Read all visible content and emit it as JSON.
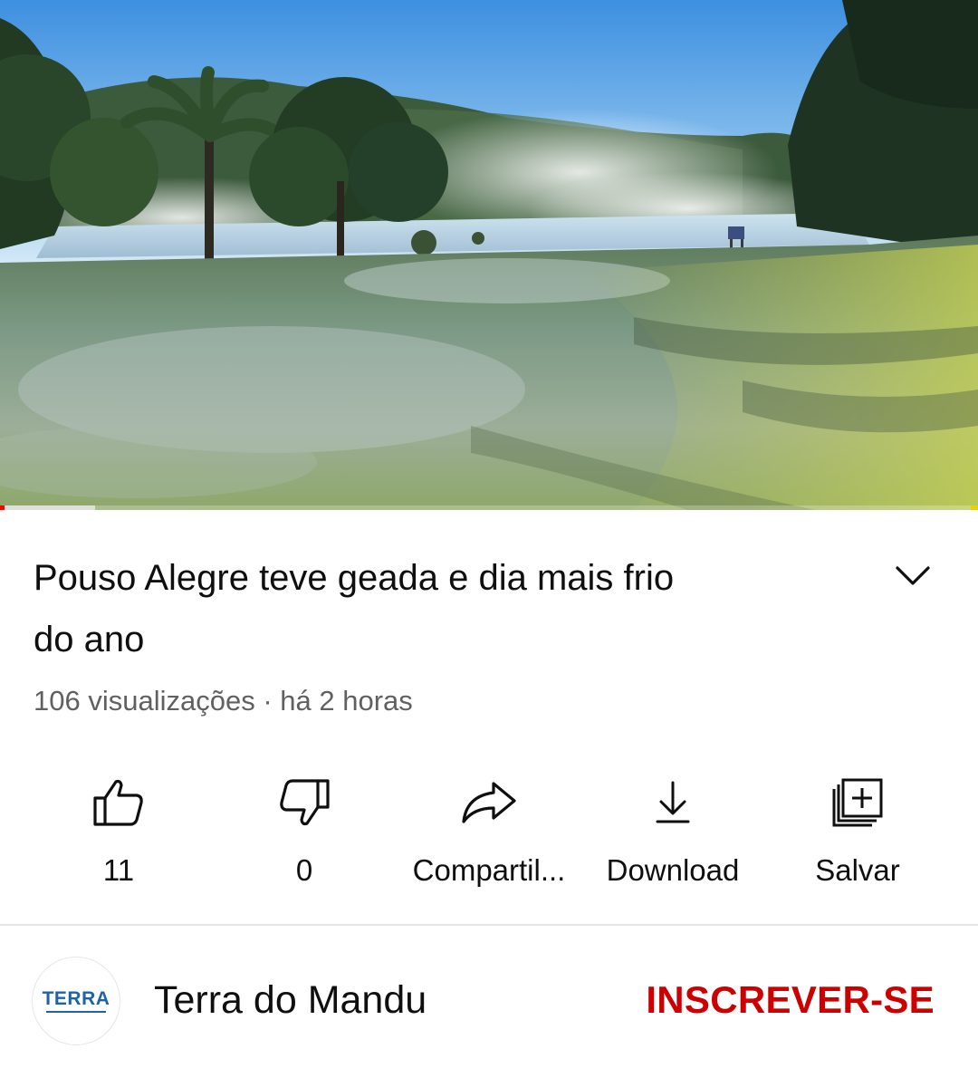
{
  "video": {
    "scene": "frosty-lakeside-meadow-thumbnail",
    "progress": {
      "played_fraction": 0.005,
      "buffered_fraction": 0.097
    }
  },
  "title": {
    "line1": "Pouso Alegre teve geada e dia mais frio",
    "line2": "do ano",
    "expand_icon": "chevron-down-icon"
  },
  "meta": {
    "views": "106 visualizações",
    "separator": "·",
    "time": "há 2 horas"
  },
  "actions": [
    {
      "icon": "thumbs-up-icon",
      "label": "11"
    },
    {
      "icon": "thumbs-down-icon",
      "label": "0"
    },
    {
      "icon": "share-icon",
      "label": "Compartil..."
    },
    {
      "icon": "download-icon",
      "label": "Download"
    },
    {
      "icon": "save-playlist-icon",
      "label": "Salvar"
    }
  ],
  "channel": {
    "avatar_logo_text": "TERRA",
    "name": "Terra do Mandu",
    "subscribe_label": "INSCREVER-SE",
    "subscribe_color": "#cc0000"
  },
  "colors": {
    "progress_played": "#ff0000",
    "logo_blue": "#1e63a7",
    "meta_gray": "#606060"
  }
}
